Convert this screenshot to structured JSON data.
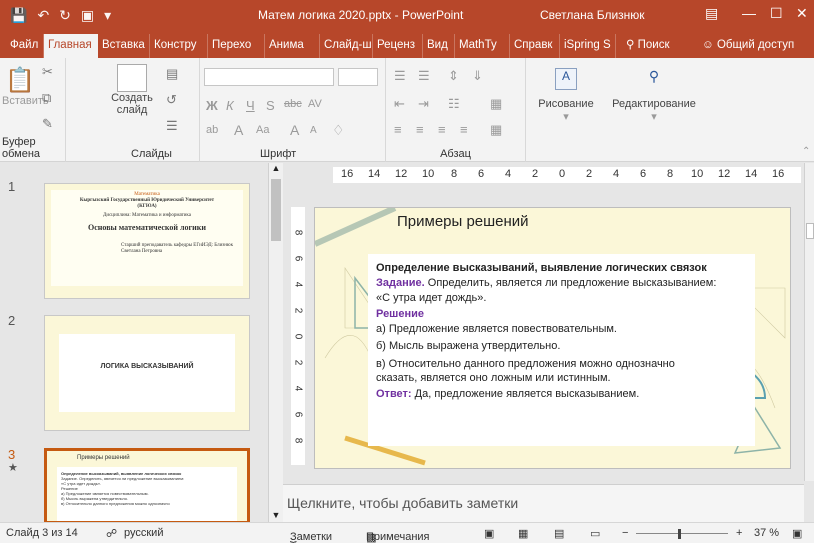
{
  "titlebar": {
    "doc_title": "Матем логика 2020.pptx  -  PowerPoint",
    "user": "Светлана Близнюк",
    "bg_color": "#b7472a"
  },
  "tabs": [
    "Файл",
    "Главная",
    "Вставка",
    "Констру",
    "Перехо",
    "Анима",
    "Слайд-ш",
    "Реценз",
    "Вид",
    "MathTy",
    "Справк",
    "iSpring S",
    "Поиск",
    "Общий доступ"
  ],
  "ribbon": {
    "paste": "Вставить",
    "create_slide": "Создать",
    "create_slide2": "слайд",
    "drawing": "Рисование",
    "editing": "Редактирование",
    "groups": {
      "clipboard": "Буфер обмена",
      "slides": "Слайды",
      "font": "Шрифт",
      "paragraph": "Абзац"
    }
  },
  "thumbnails": [
    {
      "num": "1",
      "subtitle": "Математика",
      "org": "Кыргызский Государственный Юридический Университет (КГЮА)",
      "discipline": "Дисциплина: Математика и информатика",
      "title": "Основы математической логики",
      "author": "Старший преподаватель кафедры ЕГиИЭД: Близнюк Светлана Петровна"
    },
    {
      "num": "2",
      "title": "ЛОГИКА ВЫСКАЗЫВАНИЙ"
    },
    {
      "num": "3",
      "title": "Примеры решений",
      "h": "Определение высказываний, выявление логических связок",
      "t1": "Задание. Определить, является ли предложение высказыванием:",
      "t2": "«С утра идет дождь».",
      "t3": "Решение",
      "t4": "а) Предложение является повествовательным.",
      "t5": "б) Мысль выражена утвердительно.",
      "t6": "в) Относительно данного предложения можно однозначно"
    }
  ],
  "ruler": {
    "h": [
      "16",
      "14",
      "12",
      "10",
      "8",
      "6",
      "4",
      "2",
      "0",
      "2",
      "4",
      "6",
      "8",
      "10",
      "12",
      "14",
      "16"
    ],
    "v": [
      "8",
      "6",
      "4",
      "2",
      "0",
      "2",
      "4",
      "6",
      "8"
    ]
  },
  "slide": {
    "title": "Примеры решений",
    "heading": "Определение высказываний, выявление логических связок",
    "task_label": "Задание.",
    "task_text": " Определить, является ли предложение высказыванием:",
    "quote": "«С утра идет дождь».",
    "solution": "Решение",
    "a": "а) Предложение является повествовательным.",
    "b": "б) Мысль выражена утвердительно.",
    "c1": "в) Относительно  данного  предложения  можно однозначно",
    "c2": "сказать, является оно ложным или истинным.",
    "answer_label": "Ответ:",
    "answer_text": " Да, предложение является высказыванием."
  },
  "notes_placeholder": "Щелкните, чтобы добавить заметки",
  "status": {
    "slide": "Слайд 3 из 14",
    "lang": "русский",
    "notes": "Заметки",
    "comments": "Примечания",
    "zoom": "37 %"
  }
}
